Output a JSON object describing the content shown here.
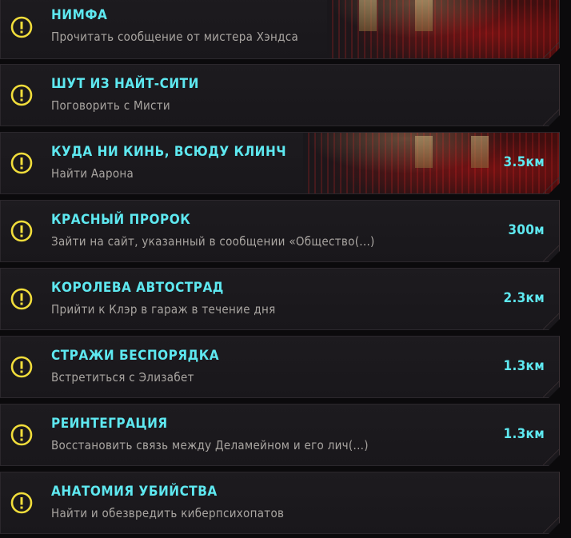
{
  "colors": {
    "accent": "#5ee8f0",
    "warning_icon": "#f1dd3b",
    "subtitle": "#a9a5a1",
    "card_bg": "#1b191d"
  },
  "quests": [
    {
      "title": "НИМФА",
      "objective": "Прочитать сообщение от мистера Хэндса",
      "distance": "",
      "icon": "exclamation-circle-icon"
    },
    {
      "title": "ШУТ ИЗ НАЙТ-СИТИ",
      "objective": "Поговорить с Мисти",
      "distance": "",
      "icon": "exclamation-circle-icon"
    },
    {
      "title": "КУДА НИ КИНЬ, ВСЮДУ КЛИНЧ",
      "objective": "Найти Аарона",
      "distance": "3.5км",
      "icon": "exclamation-circle-icon"
    },
    {
      "title": "КРАСНЫЙ ПРОРОК",
      "objective": "Зайти на сайт, указанный в сообщении «Общество(...)",
      "distance": "300м",
      "icon": "exclamation-circle-icon"
    },
    {
      "title": "КОРОЛЕВА АВТОСТРАД",
      "objective": "Прийти к Клэр в гараж в течение дня",
      "distance": "2.3км",
      "icon": "exclamation-circle-icon"
    },
    {
      "title": "СТРАЖИ БЕСПОРЯДКА",
      "objective": "Встретиться с Элизабет",
      "distance": "1.3км",
      "icon": "exclamation-circle-icon"
    },
    {
      "title": "РЕИНТЕГРАЦИЯ",
      "objective": "Восстановить связь между Деламейном и его лич(...)",
      "distance": "1.3км",
      "icon": "exclamation-circle-icon"
    },
    {
      "title": "АНАТОМИЯ УБИЙСТВА",
      "objective": "Найти и обезвредить киберпсихопатов",
      "distance": "",
      "icon": "exclamation-circle-icon"
    }
  ]
}
